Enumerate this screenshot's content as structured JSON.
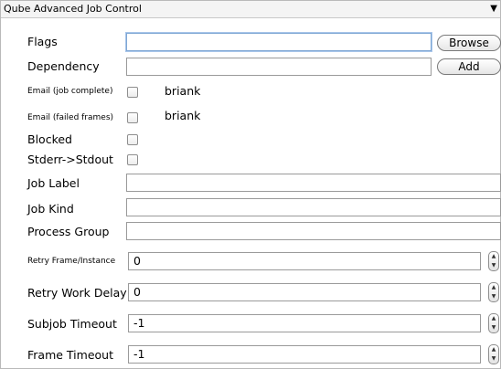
{
  "panel": {
    "title": "Qube Advanced Job Control",
    "collapse_glyph": "▼"
  },
  "flags": {
    "label": "Flags",
    "value": "",
    "button": "Browse"
  },
  "dependency": {
    "label": "Dependency",
    "value": "",
    "button": "Add"
  },
  "email_complete": {
    "label": "Email (job complete)",
    "checked": false,
    "value": "briank"
  },
  "email_failed": {
    "label": "Email (failed frames)",
    "checked": false,
    "value": "briank"
  },
  "blocked": {
    "label": "Blocked",
    "checked": false
  },
  "stderr_stdout": {
    "label": "Stderr->Stdout",
    "checked": false
  },
  "job_label": {
    "label": "Job Label",
    "value": ""
  },
  "job_kind": {
    "label": "Job Kind",
    "value": ""
  },
  "process_group": {
    "label": "Process Group",
    "value": ""
  },
  "retry_frame": {
    "label": "Retry Frame/Instance",
    "value": "0"
  },
  "retry_delay": {
    "label": "Retry Work Delay",
    "value": "0"
  },
  "subjob_timeout": {
    "label": "Subjob Timeout",
    "value": "-1"
  },
  "frame_timeout": {
    "label": "Frame Timeout",
    "value": "-1"
  },
  "stepper_glyphs": {
    "up": "▲",
    "down": "▼"
  }
}
